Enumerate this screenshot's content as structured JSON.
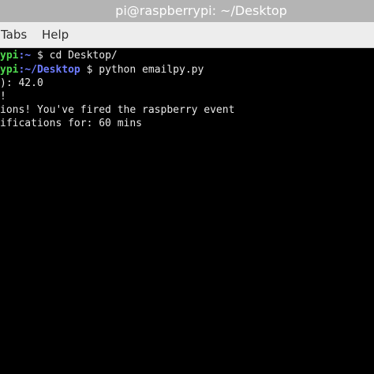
{
  "window": {
    "title": "pi@raspberrypi: ~/Desktop"
  },
  "menubar": {
    "items": [
      "Tabs",
      "Help"
    ]
  },
  "terminal": {
    "lines": [
      {
        "user_host": "ypi",
        "path": ":~",
        "prompt": " $",
        "command": " cd Desktop/"
      },
      {
        "user_host": "ypi",
        "path": ":~/Desktop",
        "prompt": " $",
        "command": " python emailpy.py"
      },
      {
        "text": "): 42.0"
      },
      {
        "text": "!"
      },
      {
        "text": "ions! You've fired the raspberry event"
      },
      {
        "text": "ifications for: 60 mins"
      }
    ]
  },
  "colors": {
    "prompt_user": "#4fd84f",
    "prompt_path": "#6f7dff",
    "text": "#e8e8e8",
    "background": "#000000"
  }
}
